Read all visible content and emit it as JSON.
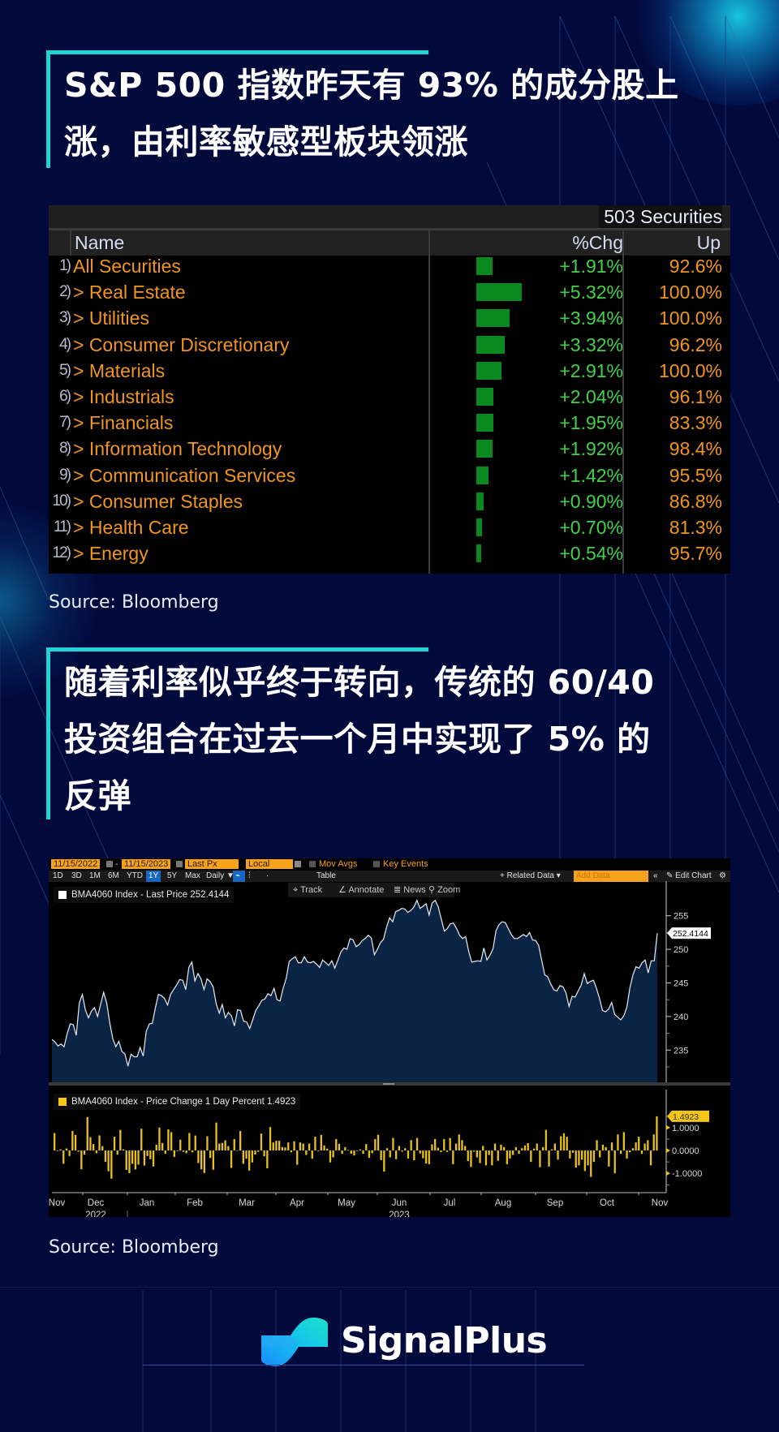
{
  "section1": {
    "title_lines": [
      "S&P 500 指数昨天有 93% 的成分股上",
      "涨，由利率敏感型板块领涨"
    ],
    "source": "Source: Bloomberg"
  },
  "table": {
    "securities_count": "503 Securities",
    "headers": {
      "name": "Name",
      "chg": "%Chg",
      "up": "Up"
    },
    "rows": [
      {
        "num": "1)",
        "name": "All Securities",
        "chg": "+1.91%",
        "chg_value": 1.91,
        "up": "92.6%"
      },
      {
        "num": "2)",
        "name": "> Real Estate",
        "chg": "+5.32%",
        "chg_value": 5.32,
        "up": "100.0%"
      },
      {
        "num": "3)",
        "name": "> Utilities",
        "chg": "+3.94%",
        "chg_value": 3.94,
        "up": "100.0%"
      },
      {
        "num": "4)",
        "name": "> Consumer Discretionary",
        "chg": "+3.32%",
        "chg_value": 3.32,
        "up": "96.2%"
      },
      {
        "num": "5)",
        "name": "> Materials",
        "chg": "+2.91%",
        "chg_value": 2.91,
        "up": "100.0%"
      },
      {
        "num": "6)",
        "name": "> Industrials",
        "chg": "+2.04%",
        "chg_value": 2.04,
        "up": "96.1%"
      },
      {
        "num": "7)",
        "name": "> Financials",
        "chg": "+1.95%",
        "chg_value": 1.95,
        "up": "83.3%"
      },
      {
        "num": "8)",
        "name": "> Information Technology",
        "chg": "+1.92%",
        "chg_value": 1.92,
        "up": "98.4%"
      },
      {
        "num": "9)",
        "name": "> Communication Services",
        "chg": "+1.42%",
        "chg_value": 1.42,
        "up": "95.5%"
      },
      {
        "num": "10)",
        "name": "> Consumer Staples",
        "chg": "+0.90%",
        "chg_value": 0.9,
        "up": "86.8%"
      },
      {
        "num": "11)",
        "name": "> Health Care",
        "chg": "+0.70%",
        "chg_value": 0.7,
        "up": "81.3%"
      },
      {
        "num": "12)",
        "name": "> Energy",
        "chg": "+0.54%",
        "chg_value": 0.54,
        "up": "95.7%"
      }
    ]
  },
  "section2": {
    "title_lines": [
      "随着利率似乎终于转向，传统的 60/40",
      "投资组合在过去一个月中实现了 5% 的",
      "反弹"
    ],
    "source": "Source: Bloomberg"
  },
  "terminal": {
    "start_date": "11/15/2022",
    "end_date": "11/15/2023",
    "field": "Last Px",
    "currency": "Local CCY",
    "mov_avgs": "Mov Avgs",
    "key_events": "Key Events",
    "periods": [
      "1D",
      "3D",
      "1M",
      "6M",
      "YTD",
      "1Y",
      "5Y",
      "Max"
    ],
    "active_period": "1Y",
    "frequency": "Daily ▼",
    "table_label": "Table",
    "related_data": "+ Related Data ▾",
    "add_data_placeholder": "Add Data",
    "collapse": "«",
    "edit_chart": "✎ Edit Chart",
    "tools": [
      {
        "icon": "crosshair-icon",
        "glyph": "⌖",
        "label": "Track"
      },
      {
        "icon": "annotate-icon",
        "glyph": "∠",
        "label": "Annotate"
      },
      {
        "icon": "news-icon",
        "glyph": "≣",
        "label": "News"
      },
      {
        "icon": "zoom-icon",
        "glyph": "⚲",
        "label": "Zoom"
      }
    ]
  },
  "chart_data": [
    {
      "type": "area",
      "title": "BMA4060 Index - Last Price 252.4144",
      "series_name": "BMA4060 Index - Last Price",
      "last_value": "252.4144",
      "ylim": [
        230.2,
        257.5
      ],
      "yticks": [
        235,
        240,
        245,
        250,
        255
      ],
      "x_range": [
        "2022-11-15",
        "2023-11-15"
      ],
      "values": [
        236.6,
        236.2,
        235.6,
        235.9,
        235.5,
        237.4,
        238.9,
        238.8,
        237.2,
        242.0,
        243.3,
        241.0,
        239.8,
        240.8,
        241.3,
        240.0,
        241.8,
        243.6,
        242.0,
        239.1,
        236.7,
        235.5,
        236.3,
        234.8,
        234.4,
        232.6,
        234.4,
        234.0,
        234.0,
        235.4,
        234.1,
        237.8,
        238.9,
        239.0,
        241.3,
        243.3,
        243.1,
        242.7,
        241.7,
        243.3,
        244.0,
        244.7,
        245.5,
        245.4,
        244.0,
        247.3,
        248.1,
        245.3,
        246.4,
        245.6,
        244.0,
        245.6,
        245.2,
        244.4,
        241.9,
        240.5,
        241.8,
        239.8,
        240.6,
        240.1,
        238.6,
        241.0,
        240.9,
        239.3,
        239.2,
        238.2,
        239.5,
        240.9,
        241.6,
        242.4,
        242.6,
        243.4,
        243.1,
        244.2,
        242.5,
        242.3,
        244.2,
        245.7,
        248.2,
        248.6,
        248.9,
        248.0,
        248.0,
        248.9,
        248.1,
        248.0,
        248.2,
        247.8,
        247.3,
        248.4,
        248.0,
        247.6,
        248.3,
        247.2,
        248.4,
        249.6,
        250.2,
        250.0,
        251.6,
        251.4,
        250.4,
        250.7,
        251.3,
        251.6,
        252.1,
        251.7,
        249.2,
        250.0,
        251.0,
        251.5,
        253.3,
        254.7,
        254.1,
        255.6,
        255.8,
        256.1,
        256.0,
        255.5,
        255.8,
        256.3,
        257.3,
        256.1,
        256.4,
        256.8,
        255.1,
        256.9,
        257.3,
        256.3,
        254.5,
        252.7,
        253.1,
        253.8,
        253.9,
        253.1,
        252.1,
        251.6,
        251.9,
        249.7,
        248.1,
        248.2,
        248.3,
        248.2,
        250.2,
        248.4,
        249.1,
        250.1,
        252.8,
        253.7,
        254.1,
        254.0,
        253.1,
        252.2,
        251.6,
        251.6,
        251.9,
        252.2,
        251.9,
        252.5,
        251.4,
        251.3,
        250.6,
        248.4,
        246.2,
        245.9,
        244.8,
        244.0,
        243.8,
        244.6,
        244.4,
        243.5,
        241.5,
        243.0,
        242.9,
        243.8,
        244.7,
        246.4,
        244.9,
        245.2,
        245.4,
        244.2,
        242.7,
        240.9,
        240.7,
        241.1,
        242.1,
        240.3,
        239.9,
        239.5,
        240.1,
        241.4,
        244.3,
        246.2,
        247.4,
        247.2,
        248.0,
        248.4,
        246.5,
        248.3,
        248.3,
        252.4
      ]
    },
    {
      "type": "bar",
      "title": "BMA4060 Index - Price Change 1 Day Percent 1.4923",
      "series_name": "BMA4060 Index - Price Change 1 Day Percent",
      "last_value": "1.4923",
      "ylim": [
        -1.7,
        1.7
      ],
      "yticks": [
        -1.0,
        0.0,
        1.0
      ],
      "ytick_labels": [
        "-1.0000",
        "0.0000",
        "1.0000"
      ],
      "x_tick_labels": [
        "Nov",
        "Dec",
        "Jan",
        "Feb",
        "Mar",
        "Apr",
        "May",
        "Jun",
        "Jul",
        "Aug",
        "Sep",
        "Oct",
        "Nov"
      ],
      "year_labels": [
        {
          "label": "2022",
          "under": "Dec"
        },
        {
          "label": "2023",
          "under": "Jun"
        }
      ],
      "values": [
        0.76,
        -0.03,
        0.05,
        -0.58,
        0.09,
        -0.24,
        0.85,
        0.68,
        -0.05,
        -0.82,
        -0.18,
        1.46,
        0.58,
        0.28,
        -0.12,
        0.66,
        0.19,
        -0.5,
        -0.91,
        -1.23,
        0.6,
        -0.18,
        0.9,
        0.05,
        -0.85,
        -0.99,
        -0.58,
        -0.83,
        -0.62,
        0.95,
        -0.66,
        -0.24,
        -0.38,
        -0.7,
        0.25,
        1.0,
        0.33,
        -0.14,
        0.92,
        0.8,
        -0.28,
        -0.03,
        0.47,
        -0.06,
        -0.12,
        0.76,
        -0.08,
        0.65,
        -0.55,
        -0.82,
        -0.98,
        0.62,
        -0.33,
        -0.84,
        1.22,
        0.3,
        0.33,
        0.44,
        0.19,
        -0.76,
        0.5,
        0.01,
        0.85,
        -0.58,
        -0.36,
        -0.88,
        -0.52,
        -0.18,
        -0.06,
        0.74,
        -0.25,
        -0.78,
        1.02,
        0.35,
        0.42,
        0.42,
        0.15,
        0.13,
        0.35,
        -0.08,
        0.4,
        -0.62,
        0.35,
        0.3,
        -0.2,
        0.3,
        -0.36,
        0.6,
        -0.02,
        0.68,
        0.22,
        0.08,
        -0.52,
        -0.3,
        0.5,
        0.29,
        -0.15,
        0.15,
        0.02,
        -0.14,
        -0.22,
        -0.02,
        0.05,
        -0.15,
        0.28,
        -0.32,
        -0.12,
        0.5,
        0.68,
        -0.42,
        -0.92,
        0.1,
        -0.3,
        0.55,
        -0.38,
        0.2,
        -0.05,
        0.1,
        -0.35,
        0.45,
        -0.43,
        0.55,
        -0.13,
        -0.34,
        -0.57,
        -0.6,
        0.27,
        0.5,
        0.12,
        -0.07,
        0.5,
        -0.06,
        0.55,
        -0.6,
        0.3,
        0.7,
        0.45,
        0.2,
        -0.46,
        -0.72,
        -0.05,
        -0.3,
        -0.55,
        0.2,
        -0.65,
        -0.2,
        -0.65,
        0.3,
        -0.45,
        0.25,
        0.15,
        -0.6,
        -0.35,
        -0.2,
        0.15,
        -0.15,
        0.1,
        0.22,
        0.32,
        -0.5,
        0.08,
        0.3,
        -0.73,
        0.15,
        0.9,
        -0.7,
        0.05,
        0.3,
        -0.4,
        0.62,
        0.75,
        0.6,
        -0.35,
        -0.1,
        -0.75,
        -0.65,
        -0.4,
        -0.9,
        -0.65,
        -1.15,
        -0.5,
        0.45,
        -0.3,
        0.25,
        0.15,
        -0.7,
        0.35,
        -1.0,
        0.7,
        -0.15,
        0.8,
        -0.35,
        -0.08,
        0.1,
        0.35,
        0.6,
        -0.15,
        0.3,
        0.45,
        -0.65,
        0.7,
        1.49
      ]
    }
  ],
  "footer": {
    "brand": "SignalPlus",
    "logo_icon": "signalplus-logo-icon"
  }
}
